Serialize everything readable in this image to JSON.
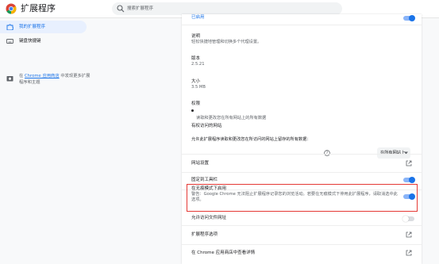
{
  "app": {
    "title": "扩展程序"
  },
  "search": {
    "placeholder": "搜索扩展程序"
  },
  "sidebar": {
    "items": [
      {
        "label": "我的扩展程序",
        "active": true
      },
      {
        "label": "键盘快捷键",
        "active": false
      }
    ],
    "store": {
      "prefix": "在 ",
      "link": "Chrome 应用商店",
      "suffix": " 中发现更多扩展程序和主题"
    }
  },
  "details": {
    "status_label": "已启用",
    "description": {
      "title": "说明",
      "value": "轻松快捷地管理和切换多个代理设置。"
    },
    "version": {
      "title": "版本",
      "value": "2.5.21"
    },
    "size": {
      "title": "大小",
      "value": "3.5 MB"
    },
    "permissions": {
      "title": "权限",
      "value": "读取和更改您在所有网站上的所有数据"
    },
    "site_access": {
      "title": "有权访问的网站",
      "desc": "允许此扩展程序读取和更改您在所访问的网站上留存的所有数据：",
      "selected": "在所有网站上"
    },
    "site_settings": "网站设置",
    "pin_toolbar": "固定到工具栏",
    "incognito": {
      "title": "在无痕模式下启用",
      "warning": "警告：Google Chrome 无法阻止扩展程序记录您的浏览活动。若要在无痕模式下停用此扩展程序，请取消选中此选项。"
    },
    "file_urls": "允许访问文件网址",
    "extension_options": "扩展程序选项",
    "view_in_store": "在 Chrome 应用商店中查看详情"
  },
  "colors": {
    "accent": "#1a73e8",
    "highlight": "#e53935"
  },
  "icons": [
    "chrome-logo-icon",
    "search-icon",
    "extension-puzzle-icon",
    "keyboard-icon",
    "store-icon",
    "help-circle-icon",
    "dropdown-caret-icon",
    "open-external-icon"
  ]
}
